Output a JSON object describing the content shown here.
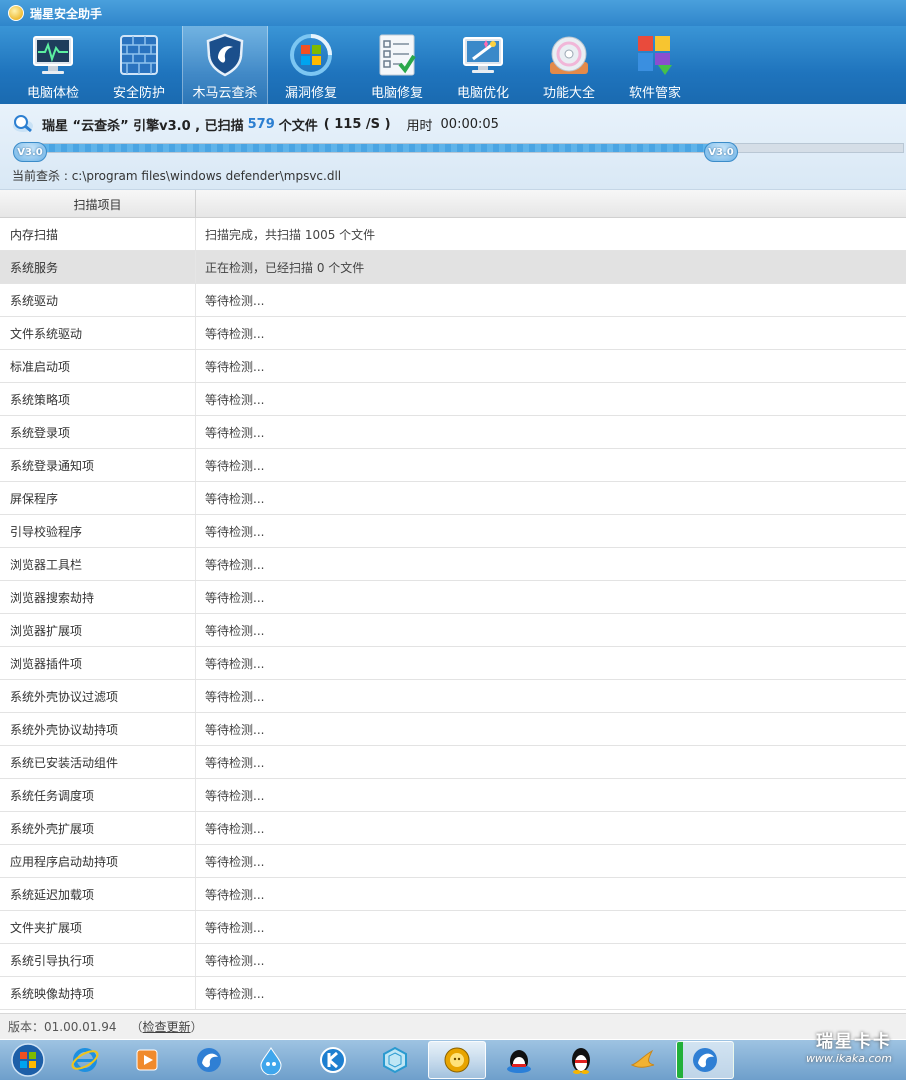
{
  "app": {
    "title": "瑞星安全助手"
  },
  "toolbar": {
    "items": [
      {
        "label": "电脑体检",
        "icon": "monitor-heartbeat-icon"
      },
      {
        "label": "安全防护",
        "icon": "firewall-icon"
      },
      {
        "label": "木马云查杀",
        "icon": "shield-icon",
        "active": true
      },
      {
        "label": "漏洞修复",
        "icon": "windows-update-icon"
      },
      {
        "label": "电脑修复",
        "icon": "checklist-icon"
      },
      {
        "label": "电脑优化",
        "icon": "wand-monitor-icon"
      },
      {
        "label": "功能大全",
        "icon": "disc-icon"
      },
      {
        "label": "软件管家",
        "icon": "apps-download-icon"
      }
    ]
  },
  "scan": {
    "engine_prefix": "瑞星 “云查杀” 引擎v3.0 , 已扫描",
    "files_count": "579",
    "files_suffix": "个文件",
    "rate": "( 115 /S )",
    "time_label": "用时",
    "time_value": "00:00:05",
    "progress": 0.795,
    "badge_left": "V3.0",
    "badge_right": "V3.0",
    "current_label": "当前查杀 :",
    "current_path": "c:\\program files\\windows defender\\mpsvc.dll"
  },
  "table": {
    "headers": [
      "扫描项目",
      ""
    ],
    "rows": [
      {
        "item": "内存扫描",
        "status": "扫描完成，共扫描 1005 个文件",
        "state": "done"
      },
      {
        "item": "系统服务",
        "status": "正在检测，已经扫描 0 个文件",
        "state": "current"
      },
      {
        "item": "系统驱动",
        "status": "等待检测...",
        "state": "waiting"
      },
      {
        "item": "文件系统驱动",
        "status": "等待检测...",
        "state": "waiting"
      },
      {
        "item": "标准启动项",
        "status": "等待检测...",
        "state": "waiting"
      },
      {
        "item": "系统策略项",
        "status": "等待检测...",
        "state": "waiting"
      },
      {
        "item": "系统登录项",
        "status": "等待检测...",
        "state": "waiting"
      },
      {
        "item": "系统登录通知项",
        "status": "等待检测...",
        "state": "waiting"
      },
      {
        "item": "屏保程序",
        "status": "等待检测...",
        "state": "waiting"
      },
      {
        "item": "引导校验程序",
        "status": "等待检测...",
        "state": "waiting"
      },
      {
        "item": "浏览器工具栏",
        "status": "等待检测...",
        "state": "waiting"
      },
      {
        "item": "浏览器搜索劫持",
        "status": "等待检测...",
        "state": "waiting"
      },
      {
        "item": "浏览器扩展项",
        "status": "等待检测...",
        "state": "waiting"
      },
      {
        "item": "浏览器插件项",
        "status": "等待检测...",
        "state": "waiting"
      },
      {
        "item": "系统外壳协议过滤项",
        "status": "等待检测...",
        "state": "waiting"
      },
      {
        "item": "系统外壳协议劫持项",
        "status": "等待检测...",
        "state": "waiting"
      },
      {
        "item": "系统已安装活动组件",
        "status": "等待检测...",
        "state": "waiting"
      },
      {
        "item": "系统任务调度项",
        "status": "等待检测...",
        "state": "waiting"
      },
      {
        "item": "系统外壳扩展项",
        "status": "等待检测...",
        "state": "waiting"
      },
      {
        "item": "应用程序启动劫持项",
        "status": "等待检测...",
        "state": "waiting"
      },
      {
        "item": "系统延迟加载项",
        "status": "等待检测...",
        "state": "waiting"
      },
      {
        "item": "文件夹扩展项",
        "status": "等待检测...",
        "state": "waiting"
      },
      {
        "item": "系统引导执行项",
        "status": "等待检测...",
        "state": "waiting"
      },
      {
        "item": "系统映像劫持项",
        "status": "等待检测...",
        "state": "waiting"
      }
    ]
  },
  "footer": {
    "version_label": "版本：01.00.01.94",
    "update_open": "（",
    "update_link": "检查更新",
    "update_close": "）"
  },
  "watermark": {
    "line1": "瑞星卡卡",
    "line2": "www.ikaka.com"
  },
  "taskbar": {
    "items": [
      {
        "icon": "windows-start-icon"
      },
      {
        "icon": "internet-explorer-icon"
      },
      {
        "icon": "media-player-icon"
      },
      {
        "icon": "rising-globe-icon"
      },
      {
        "icon": "water-drop-icon"
      },
      {
        "icon": "k-circle-icon"
      },
      {
        "icon": "shield-hex-icon"
      },
      {
        "icon": "rising-lion-icon",
        "active": true
      },
      {
        "icon": "qq-game-icon"
      },
      {
        "icon": "qq-penguin-icon"
      },
      {
        "icon": "bird-icon"
      },
      {
        "icon": "rising-globe-active-icon",
        "active": true
      }
    ]
  },
  "colors": {
    "accent": "#2c7fd1",
    "toolbar": "#1f74bd",
    "current_row": "#e2e2e2"
  }
}
